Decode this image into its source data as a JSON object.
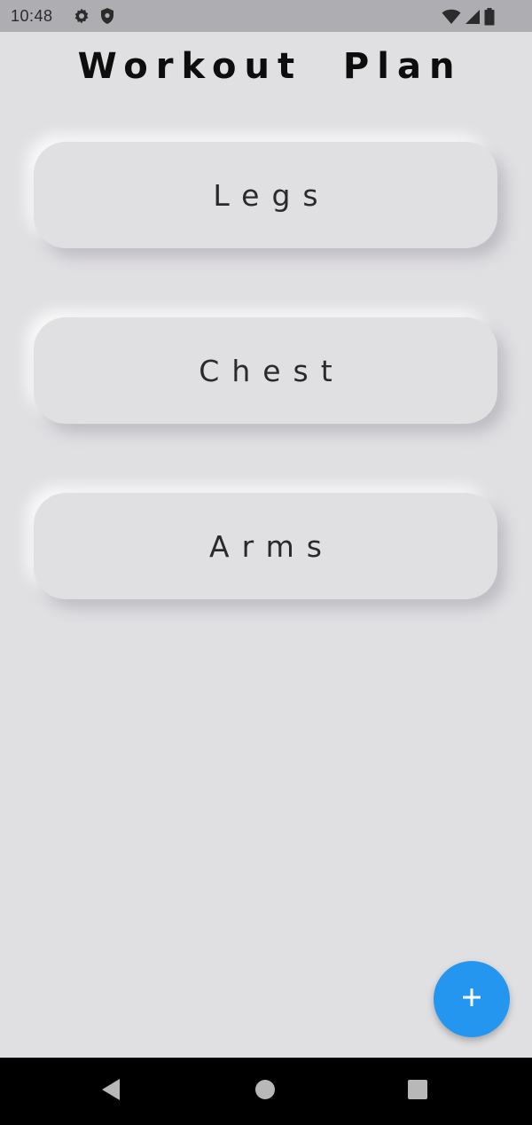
{
  "status_bar": {
    "time": "10:48",
    "left_icons": [
      "gear-icon",
      "shield-icon"
    ],
    "right_icons": [
      "wifi-icon",
      "signal-icon",
      "battery-icon"
    ]
  },
  "header": {
    "title": "Workout  Plan"
  },
  "plans": [
    {
      "label": "Legs"
    },
    {
      "label": "Chest"
    },
    {
      "label": "Arms"
    }
  ],
  "fab": {
    "icon": "plus-icon",
    "color": "#2596f0"
  },
  "nav": {
    "buttons": [
      "back-icon",
      "home-icon",
      "recents-icon"
    ]
  },
  "colors": {
    "background": "#e0dfe2",
    "status_bar": "#aeadb1",
    "accent": "#2596f0"
  }
}
